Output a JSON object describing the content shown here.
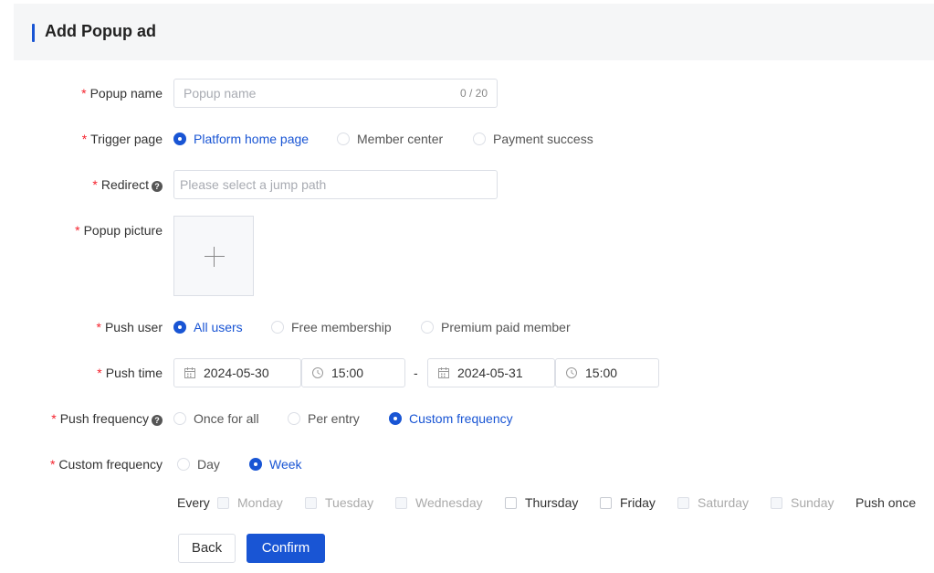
{
  "header": {
    "title": "Add Popup ad"
  },
  "form": {
    "popup_name": {
      "label": "Popup name",
      "placeholder": "Popup name",
      "counter": "0 / 20"
    },
    "trigger_page": {
      "label": "Trigger page",
      "options": [
        "Platform home page",
        "Member center",
        "Payment success"
      ],
      "selected": "Platform home page"
    },
    "redirect": {
      "label": "Redirect",
      "placeholder": "Please select a jump path"
    },
    "popup_picture": {
      "label": "Popup picture"
    },
    "push_user": {
      "label": "Push user",
      "options": [
        "All users",
        "Free membership",
        "Premium paid member"
      ],
      "selected": "All users"
    },
    "push_time": {
      "label": "Push time",
      "start_date": "2024-05-30",
      "start_time": "15:00",
      "separator": "-",
      "end_date": "2024-05-31",
      "end_time": "15:00"
    },
    "push_frequency": {
      "label": "Push frequency",
      "options": [
        "Once for all",
        "Per entry",
        "Custom frequency"
      ],
      "selected": "Custom frequency"
    },
    "custom_frequency": {
      "label": "Custom frequency",
      "options": [
        "Day",
        "Week"
      ],
      "selected": "Week"
    },
    "week": {
      "prefix": "Every",
      "days": [
        "Monday",
        "Tuesday",
        "Wednesday",
        "Thursday",
        "Friday",
        "Saturday",
        "Sunday"
      ],
      "suffix": "Push once"
    }
  },
  "buttons": {
    "back": "Back",
    "confirm": "Confirm"
  },
  "colors": {
    "accent": "#1955d4",
    "required": "#f5222d"
  }
}
